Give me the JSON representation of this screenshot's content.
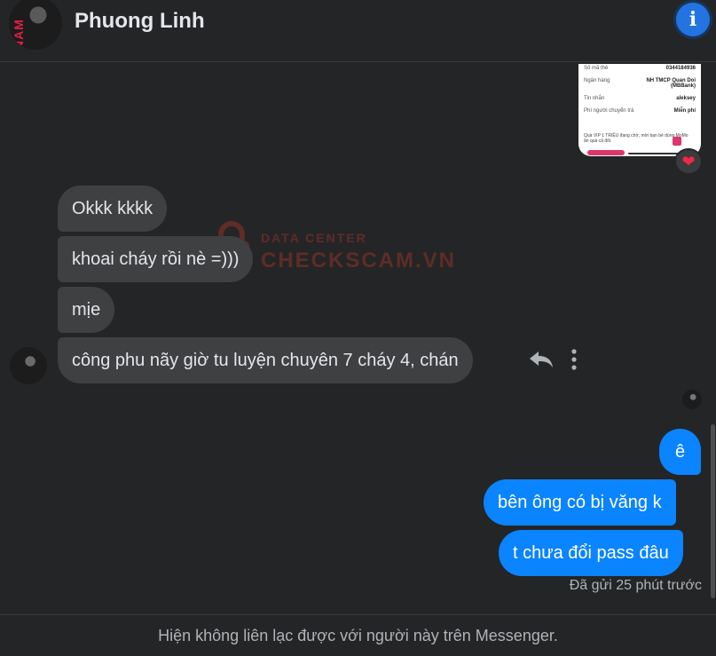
{
  "header": {
    "contact_name": "Phuong Linh",
    "avatar_brand_text": "NAM",
    "info_icon": "info-icon"
  },
  "attachment": {
    "rows": [
      {
        "label": "Số mã thẻ",
        "value": "0344184936"
      },
      {
        "label": "Ngân hàng",
        "value": "NH TMCP Quan Doi (MBBank)"
      },
      {
        "label": "Tin nhắn",
        "value": "aleksey"
      },
      {
        "label": "Phí người chuyển trả",
        "value": "Miễn phí"
      }
    ],
    "promo": "Quà VIP 1 TRIỆU đang chờ, mời bạn bè dùng MoMo ăn quà cả đôi.",
    "reaction": "❤"
  },
  "messages": {
    "incoming": [
      {
        "text": "Okkk kkkk"
      },
      {
        "text": "khoai cháy rồi nè =)))"
      },
      {
        "text": "mịe"
      },
      {
        "text": "công phu nãy giờ tu luyện chuyên 7 cháy 4, chán"
      }
    ],
    "outgoing": [
      {
        "text": "ê"
      },
      {
        "text": "bên ông có bị văng k"
      },
      {
        "text": "t chưa đổi pass đâu"
      }
    ],
    "sent_status": "Đã gửi 25 phút trước"
  },
  "watermark": {
    "small": "DATA CENTER",
    "big": "CHECKSCAM.VN"
  },
  "footer": {
    "notice": "Hiện không liên lạc được với người này trên Messenger."
  },
  "colors": {
    "background": "#242526",
    "incoming_bubble": "#3e4042",
    "outgoing_bubble": "#0a84ff",
    "accent": "#2374e1"
  }
}
